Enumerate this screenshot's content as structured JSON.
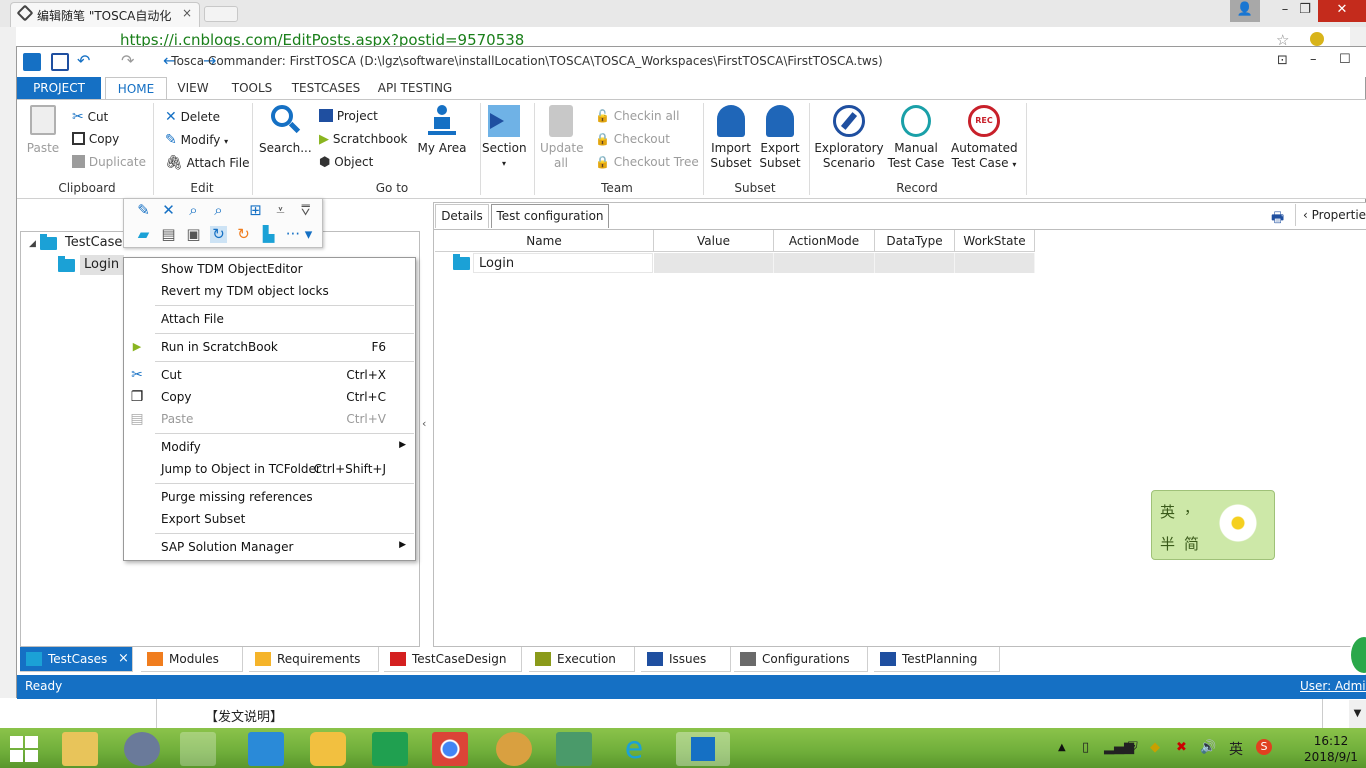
{
  "browser": {
    "tab_title": "编辑随笔 \"TOSCA自动化",
    "tab_close": "×",
    "address": "https://i.cnblogs.com/EditPosts.aspx?postid=9570538",
    "page_fragment": "【发文说明】",
    "win_min": "–",
    "win_max": "❐",
    "win_close": "✕"
  },
  "window": {
    "title": "Tosca Commander: FirstTOSCA (D:\\lgz\\software\\installLocation\\TOSCA\\TOSCA_Workspaces\\FirstTOSCA\\FirstTOSCA.tws)"
  },
  "ribbon": {
    "tabs": [
      "PROJECT",
      "HOME",
      "VIEW",
      "TOOLS",
      "TESTCASES",
      "API TESTING"
    ],
    "clipboard": {
      "paste": "Paste",
      "cut": "Cut",
      "copy": "Copy",
      "duplicate": "Duplicate",
      "label": "Clipboard"
    },
    "edit": {
      "delete": "Delete",
      "modify": "Modify",
      "attach": "Attach File",
      "label": "Edit"
    },
    "goto": {
      "search": "Search...",
      "project": "Project",
      "scratchbook": "Scratchbook",
      "object": "Object",
      "myarea": "My Area",
      "section": "Section",
      "label": "Go to"
    },
    "team": {
      "update_l1": "Update",
      "update_l2": "all",
      "checkin": "Checkin all",
      "checkout": "Checkout",
      "checkout_tree": "Checkout Tree",
      "label": "Team"
    },
    "subset": {
      "import_l1": "Import",
      "import_l2": "Subset",
      "export_l1": "Export",
      "export_l2": "Subset",
      "label": "Subset"
    },
    "record": {
      "expl_l1": "Exploratory",
      "expl_l2": "Scenario",
      "manual_l1": "Manual",
      "manual_l2": "Test Case",
      "auto_l1": "Automated",
      "auto_l2": "Test Case",
      "rec_badge": "REC",
      "label": "Record"
    }
  },
  "tree": {
    "root": "TestCases",
    "child": "Login"
  },
  "context_menu": {
    "items": [
      {
        "label": "Show TDM ObjectEditor",
        "shortcut": ""
      },
      {
        "label": "Revert my TDM object locks",
        "shortcut": ""
      },
      {
        "label": "Attach File",
        "shortcut": ""
      },
      {
        "label": "Run in ScratchBook",
        "shortcut": "F6"
      },
      {
        "label": "Cut",
        "shortcut": "Ctrl+X"
      },
      {
        "label": "Copy",
        "shortcut": "Ctrl+C"
      },
      {
        "label": "Paste",
        "shortcut": "Ctrl+V"
      },
      {
        "label": "Modify",
        "shortcut": ""
      },
      {
        "label": "Jump to Object in TCFolder",
        "shortcut": "Ctrl+Shift+J"
      },
      {
        "label": "Purge missing references",
        "shortcut": ""
      },
      {
        "label": "Export Subset",
        "shortcut": ""
      },
      {
        "label": "SAP Solution Manager",
        "shortcut": ""
      }
    ]
  },
  "details": {
    "tabs": [
      "Details",
      "Test configuration"
    ],
    "properties": "Properties",
    "columns": [
      "Name",
      "Value",
      "ActionMode",
      "DataType",
      "WorkState"
    ],
    "row_name": "Login"
  },
  "bottom_tabs": [
    {
      "label": "TestCases",
      "color": "#1ba1d6"
    },
    {
      "label": "Modules",
      "color": "#f07d1e"
    },
    {
      "label": "Requirements",
      "color": "#f5b42a"
    },
    {
      "label": "TestCaseDesign",
      "color": "#d42020"
    },
    {
      "label": "Execution",
      "color": "#8a9a1a"
    },
    {
      "label": "Issues",
      "color": "#1f4fa0"
    },
    {
      "label": "Configurations",
      "color": "#6a6a6a"
    },
    {
      "label": "TestPlanning",
      "color": "#1f4fa0"
    }
  ],
  "bottom_tab_close": "×",
  "status": {
    "left": "Ready",
    "right": "User: Admin"
  },
  "ime": {
    "c1": "英",
    "c2": "，",
    "c3": "半",
    "c4": "简"
  },
  "taskbar": {
    "time": "16:12",
    "date": "2018/9/1",
    "ime_lang": "英"
  },
  "colors": {
    "accent": "#1570c4",
    "statusbar": "#1570c4",
    "taskbar": "#6fae3a"
  }
}
